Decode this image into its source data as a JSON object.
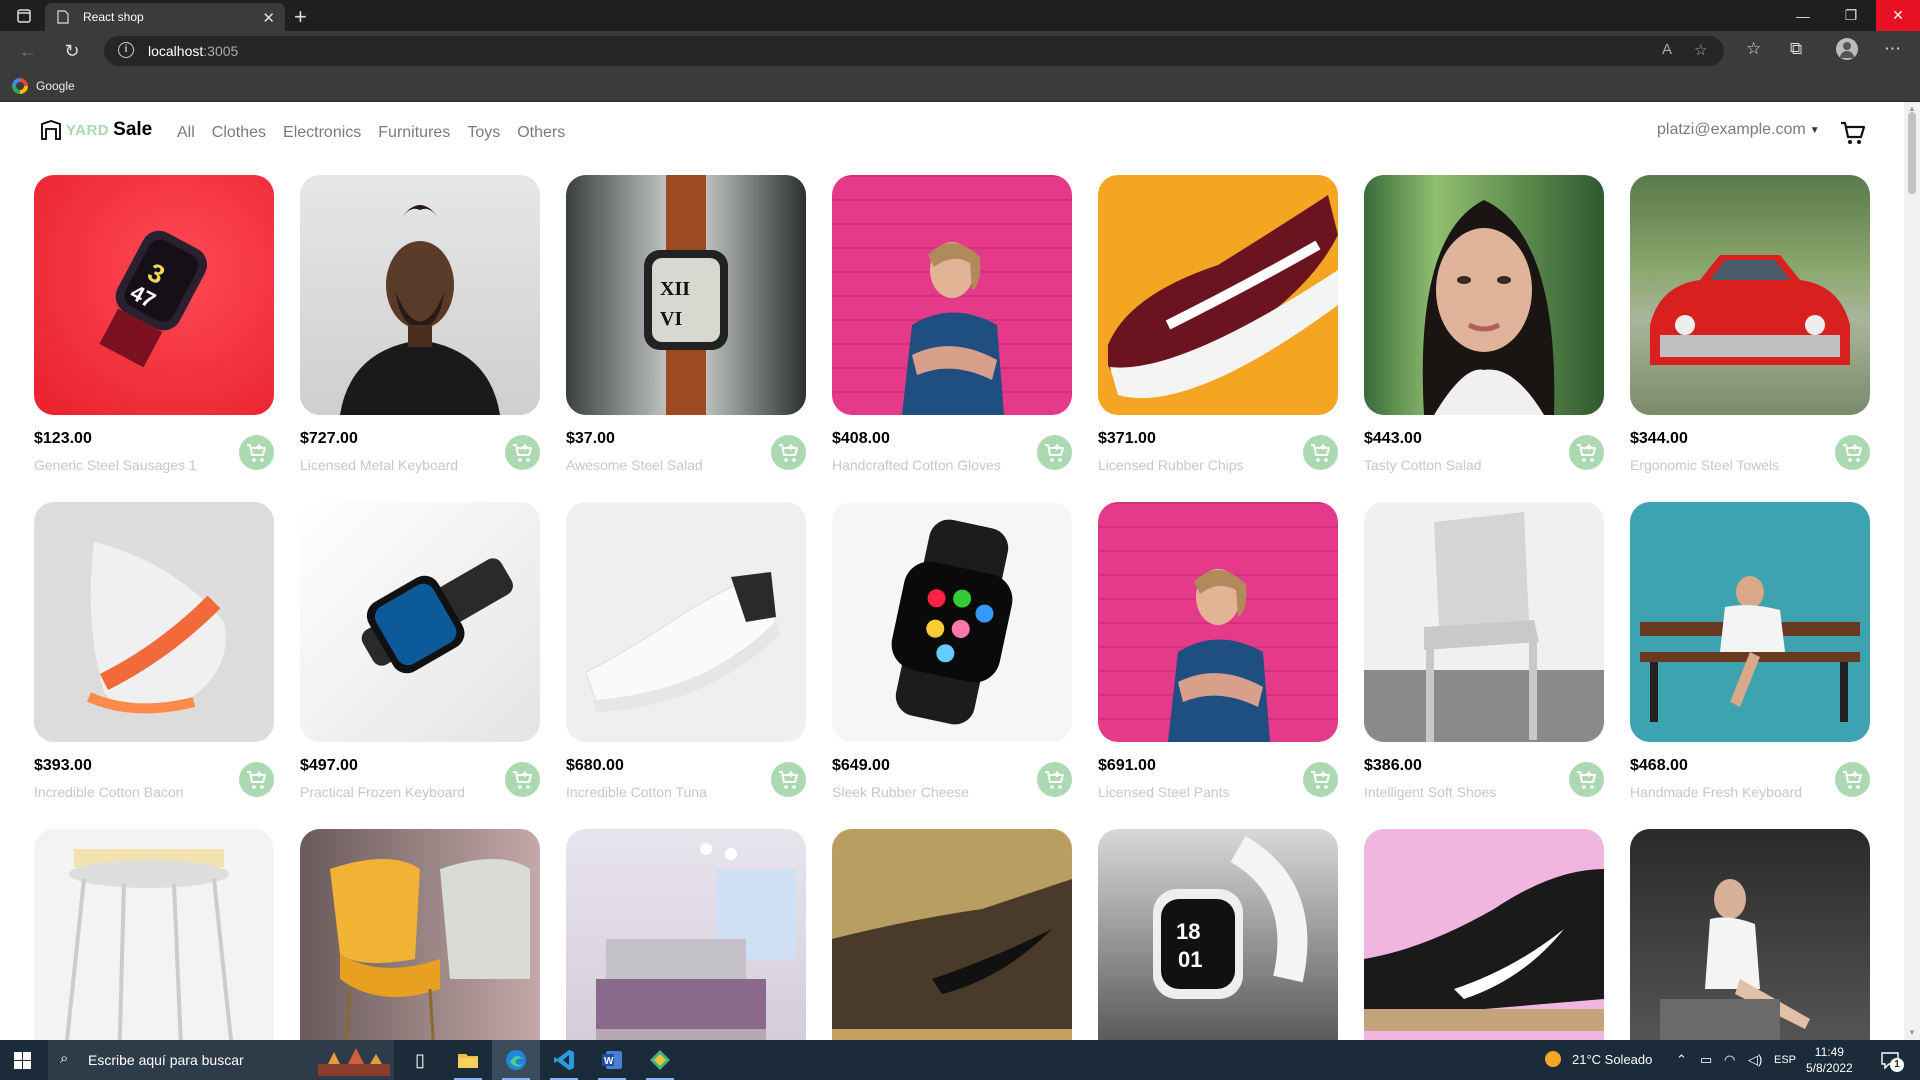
{
  "browser": {
    "tab_title": "React shop",
    "url_host": "localhost",
    "url_port": ":3005",
    "bookmark_label": "Google"
  },
  "app": {
    "logo_yard": "YARD",
    "logo_sale": "Sale",
    "nav": [
      "All",
      "Clothes",
      "Electronics",
      "Furnitures",
      "Toys",
      "Others"
    ],
    "user_email": "platzi@example.com"
  },
  "products": [
    {
      "price": "$123.00",
      "name": "Generic Steel Sausages 1",
      "image": "red-smartwatch-image"
    },
    {
      "price": "$727.00",
      "name": "Licensed Metal Keyboard",
      "image": "man-portrait-image"
    },
    {
      "price": "$37.00",
      "name": "Awesome Steel Salad",
      "image": "orange-strap-watch-image"
    },
    {
      "price": "$408.00",
      "name": "Handcrafted Cotton Gloves",
      "image": "woman-pink-wall-image"
    },
    {
      "price": "$371.00",
      "name": "Licensed Rubber Chips",
      "image": "maroon-sneaker-image"
    },
    {
      "price": "$443.00",
      "name": "Tasty Cotton Salad",
      "image": "woman-portrait-image"
    },
    {
      "price": "$344.00",
      "name": "Ergonomic Steel Towels",
      "image": "red-car-image"
    },
    {
      "price": "$393.00",
      "name": "Incredible Cotton Bacon",
      "image": "orange-running-shoe-image"
    },
    {
      "price": "$497.00",
      "name": "Practical Frozen Keyboard",
      "image": "black-smartwatch-image"
    },
    {
      "price": "$680.00",
      "name": "Incredible Cotton Tuna",
      "image": "white-sneaker-image"
    },
    {
      "price": "$649.00",
      "name": "Sleek Rubber Cheese",
      "image": "apple-watch-image"
    },
    {
      "price": "$691.00",
      "name": "Licensed Steel Pants",
      "image": "woman-pink-wall-image"
    },
    {
      "price": "$386.00",
      "name": "Intelligent Soft Shoes",
      "image": "white-chair-image"
    },
    {
      "price": "$468.00",
      "name": "Handmade Fresh Keyboard",
      "image": "woman-bench-image"
    },
    {
      "price": "",
      "name": "",
      "image": "white-stool-image"
    },
    {
      "price": "",
      "name": "",
      "image": "yellow-chairs-image"
    },
    {
      "price": "",
      "name": "",
      "image": "bedroom-image"
    },
    {
      "price": "",
      "name": "",
      "image": "brown-sneaker-image"
    },
    {
      "price": "",
      "name": "",
      "image": "white-watch-image"
    },
    {
      "price": "",
      "name": "",
      "image": "black-nike-shoe-image"
    },
    {
      "price": "",
      "name": "",
      "image": "woman-sitting-image"
    }
  ],
  "taskbar": {
    "search_placeholder": "Escribe aquí para buscar",
    "weather": "21°C  Soleado",
    "language": "ESP",
    "time": "11:49",
    "date": "5/8/2022",
    "notification_count": "1"
  },
  "colors": {
    "accent": "#acd9b2",
    "muted_text": "#c7c7c7",
    "nav_text": "#7b7b7b"
  }
}
